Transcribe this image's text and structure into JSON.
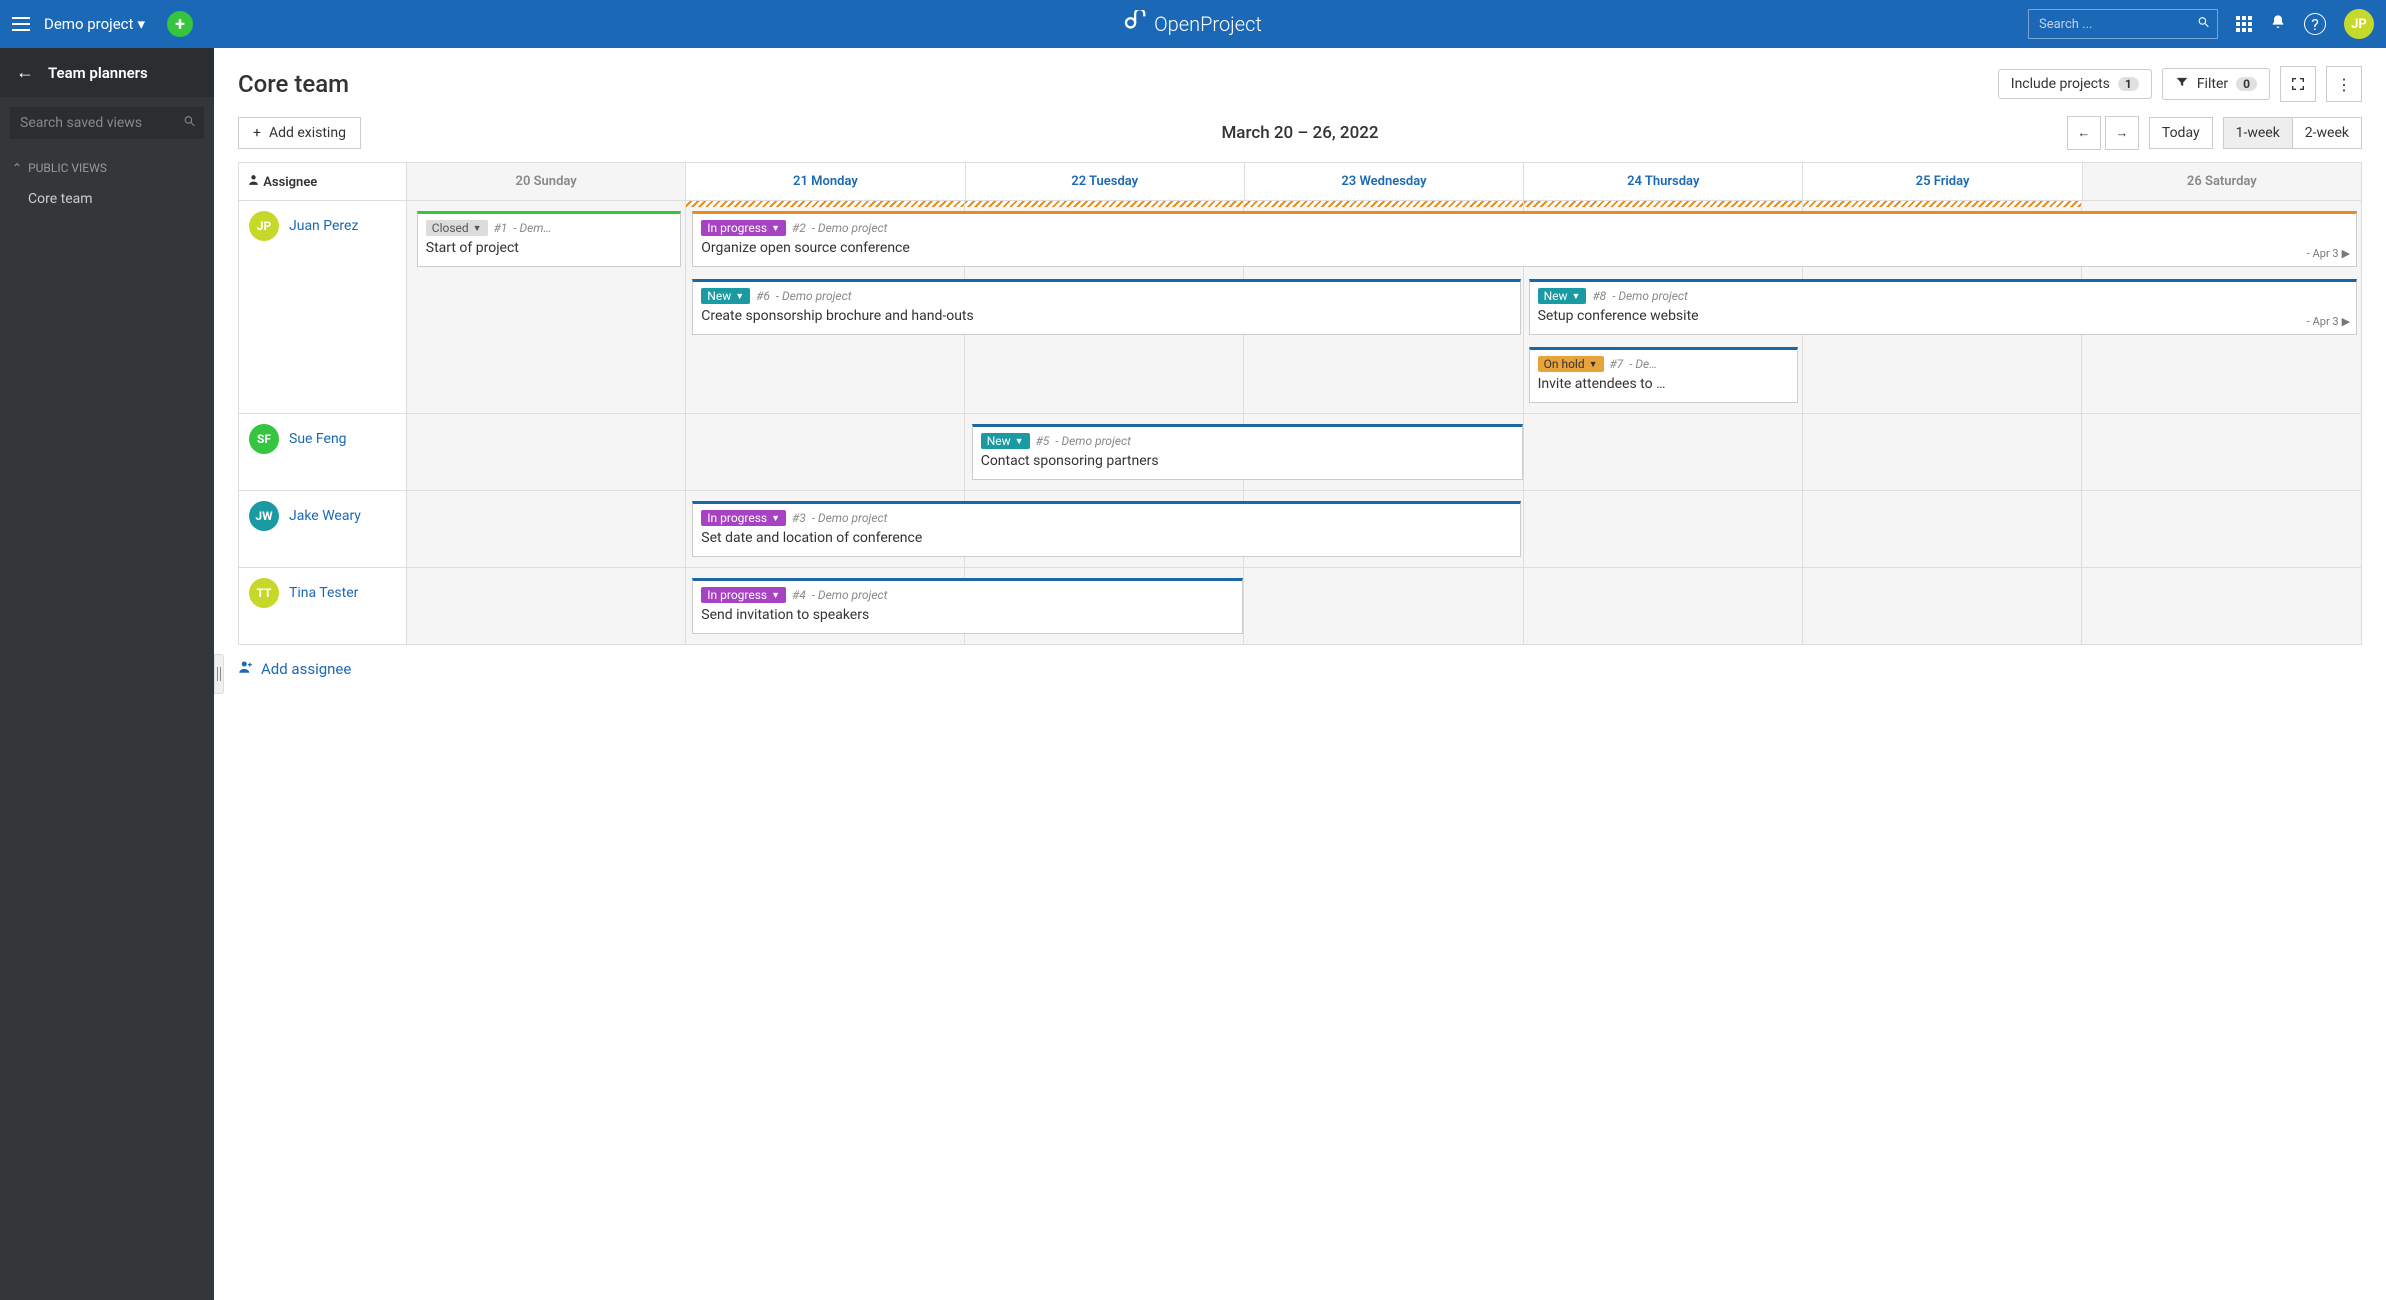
{
  "topbar": {
    "project": "Demo project",
    "search_placeholder": "Search ...",
    "brand": "OpenProject",
    "avatar": "JP"
  },
  "sidebar": {
    "title": "Team planners",
    "search_placeholder": "Search saved views",
    "section": "Public views",
    "items": [
      "Core team"
    ]
  },
  "page": {
    "title": "Core team",
    "include_projects": "Include projects",
    "include_count": "1",
    "filter_label": "Filter",
    "filter_count": "0",
    "add_existing": "Add existing",
    "date_range": "March 20 – 26, 2022",
    "today": "Today",
    "one_week": "1-week",
    "two_week": "2-week"
  },
  "columns": {
    "assignee": "Assignee",
    "days": [
      {
        "label": "20 Sunday",
        "weekend": true
      },
      {
        "label": "21 Monday",
        "weekend": false
      },
      {
        "label": "22 Tuesday",
        "weekend": false
      },
      {
        "label": "23 Wednesday",
        "weekend": false
      },
      {
        "label": "24 Thursday",
        "weekend": false
      },
      {
        "label": "25 Friday",
        "weekend": false
      },
      {
        "label": "26 Saturday",
        "weekend": true
      }
    ]
  },
  "assignees": [
    {
      "initials": "JP",
      "name": "Juan Perez",
      "color": "#c6d92b"
    },
    {
      "initials": "SF",
      "name": "Sue Feng",
      "color": "#35c53f"
    },
    {
      "initials": "JW",
      "name": "Jake Weary",
      "color": "#1a9ba3"
    },
    {
      "initials": "TT",
      "name": "Tina Tester",
      "color": "#c6d92b"
    }
  ],
  "cards": {
    "start": {
      "status": "Closed",
      "id": "#1",
      "proj": "- Dem…",
      "title": "Start of project"
    },
    "organize": {
      "status": "In progress",
      "id": "#2",
      "proj": "- Demo project",
      "title": "Organize open source conference",
      "extend": "- Apr 3"
    },
    "brochure": {
      "status": "New",
      "id": "#6",
      "proj": "- Demo project",
      "title": "Create sponsorship brochure and hand-outs"
    },
    "website": {
      "status": "New",
      "id": "#8",
      "proj": "- Demo project",
      "title": "Setup conference website",
      "extend": "- Apr 3"
    },
    "invite": {
      "status": "On hold",
      "id": "#7",
      "proj": "- De…",
      "title": "Invite attendees to …"
    },
    "contact": {
      "status": "New",
      "id": "#5",
      "proj": "- Demo project",
      "title": "Contact sponsoring partners"
    },
    "setdate": {
      "status": "In progress",
      "id": "#3",
      "proj": "- Demo project",
      "title": "Set date and location of conference"
    },
    "speakers": {
      "status": "In progress",
      "id": "#4",
      "proj": "- Demo project",
      "title": "Send invitation to speakers"
    }
  },
  "add_assignee": "Add assignee"
}
